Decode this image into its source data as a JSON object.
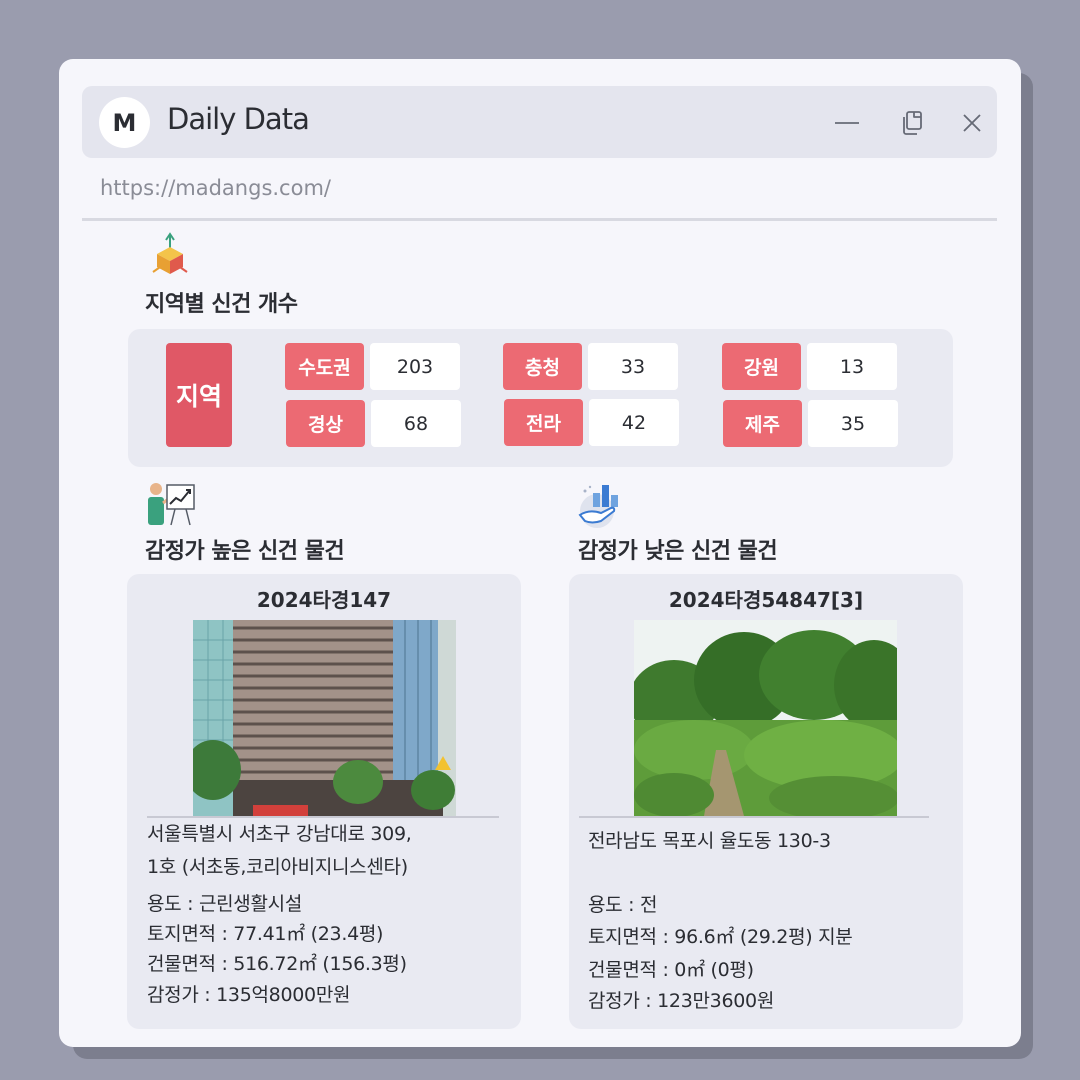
{
  "window": {
    "logo_letter": "M",
    "title": "Daily Data",
    "url": "https://madangs.com/"
  },
  "icons": {
    "minimize": "minimize-icon",
    "copy": "copy-icon",
    "close": "close-icon",
    "region_section": "3d-axis-cube-icon",
    "high_section": "presenter-chart-icon",
    "low_section": "hand-bar-chart-icon"
  },
  "region_section": {
    "title": "지역별 신건 개수",
    "label": "지역",
    "regions": [
      {
        "name": "수도권",
        "count": "203"
      },
      {
        "name": "충청",
        "count": "33"
      },
      {
        "name": "강원",
        "count": "13"
      },
      {
        "name": "경상",
        "count": "68"
      },
      {
        "name": "전라",
        "count": "42"
      },
      {
        "name": "제주",
        "count": "35"
      }
    ]
  },
  "high_section": {
    "title": "감정가 높은 신건 물건",
    "case_no": "2024타경147",
    "address_line1": "서울특별시 서초구 강남대로 309,",
    "address_line2": "1호 (서초동,코리아비지니스센타)",
    "usage": "용도 : 근린생활시설",
    "land_area": "토지면적 : 77.41㎡ (23.4평)",
    "building_area": "건물면적 : 516.72㎡ (156.3평)",
    "appraisal": "감정가 : 135억8000만원"
  },
  "low_section": {
    "title": "감정가 낮은 신건 물건",
    "case_no": "2024타경54847[3]",
    "address_line1": "전라남도 목포시 율도동 130-3",
    "usage": "용도 : 전",
    "land_area": "토지면적 : 96.6㎡ (29.2평) 지분",
    "building_area": "건물면적 : 0㎡ (0평)",
    "appraisal": "감정가 : 123만3600원"
  },
  "colors": {
    "accent_dark": "#e05866",
    "accent": "#ec6a73",
    "panel": "#e9eaf2",
    "background": "#9a9cae"
  }
}
